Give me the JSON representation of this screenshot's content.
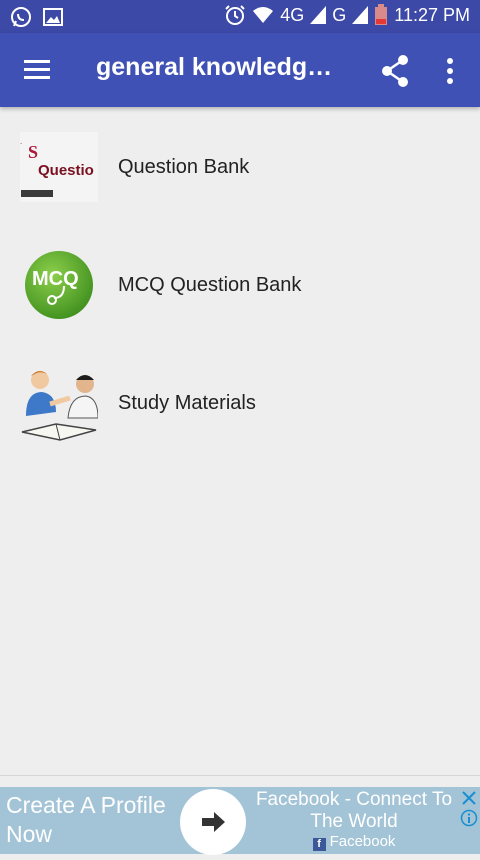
{
  "status_bar": {
    "network_4g": "4G",
    "network_g": "G",
    "time": "11:27 PM"
  },
  "app_bar": {
    "title": "general knowledge…",
    "menu_icon": "hamburger-menu-icon",
    "share_icon": "share-icon",
    "more_icon": "more-vert-icon"
  },
  "list": {
    "items": [
      {
        "label": "Question Bank",
        "icon": "question-bank-icon",
        "icon_text": "Questio"
      },
      {
        "label": "MCQ Question Bank",
        "icon": "mcq-icon",
        "icon_text": "MCQ"
      },
      {
        "label": "Study Materials",
        "icon": "study-materials-icon"
      }
    ]
  },
  "ad": {
    "left_text": "Create A Profile Now",
    "headline": "Facebook - Connect To The World",
    "source": "Facebook",
    "background": "#a3c3d6"
  },
  "colors": {
    "app_bar": "#3f51b5",
    "status_bar": "#3c49a6",
    "background": "#eeeeee",
    "mcq_green": "#56a52a"
  }
}
